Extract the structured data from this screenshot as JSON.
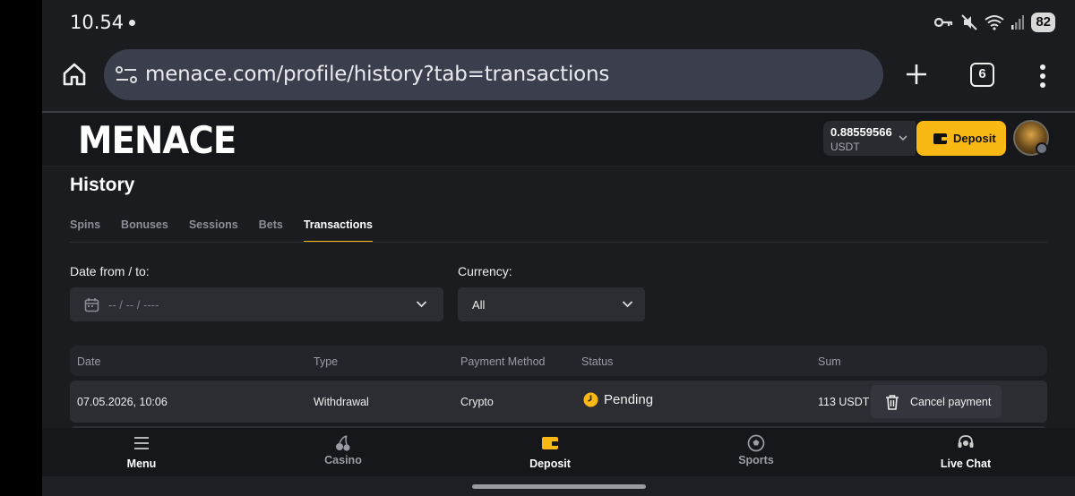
{
  "status_bar": {
    "time": "10.54",
    "battery": "82"
  },
  "browser": {
    "url": "menace.com/profile/history?tab=transactions",
    "tab_count": "6"
  },
  "header": {
    "logo": "MENACE",
    "balance_amount": "0.88559566",
    "balance_currency": "USDT",
    "deposit_label": "Deposit"
  },
  "page": {
    "title": "History",
    "tabs": [
      {
        "label": "Spins",
        "active": false
      },
      {
        "label": "Bonuses",
        "active": false
      },
      {
        "label": "Sessions",
        "active": false
      },
      {
        "label": "Bets",
        "active": false
      },
      {
        "label": "Transactions",
        "active": true
      }
    ]
  },
  "filters": {
    "date_label": "Date from / to:",
    "date_placeholder": "-- / -- / ----",
    "currency_label": "Currency:",
    "currency_value": "All"
  },
  "table": {
    "columns": [
      "Date",
      "Type",
      "Payment Method",
      "Status",
      "Sum"
    ],
    "rows": [
      {
        "date": "07.05.2026, 10:06",
        "type": "Withdrawal",
        "method": "Crypto",
        "status": "Pending",
        "sum": "113 USDT",
        "action": "Cancel payment"
      }
    ]
  },
  "bottom_nav": [
    {
      "label": "Menu",
      "icon": "menu-icon"
    },
    {
      "label": "Casino",
      "icon": "cherries-icon"
    },
    {
      "label": "Deposit",
      "icon": "wallet-icon"
    },
    {
      "label": "Sports",
      "icon": "soccer-ball-icon"
    },
    {
      "label": "Live Chat",
      "icon": "headset-icon"
    }
  ],
  "colors": {
    "accent": "#f9b814",
    "background": "#1b1c20",
    "panel": "#2c2d33"
  }
}
